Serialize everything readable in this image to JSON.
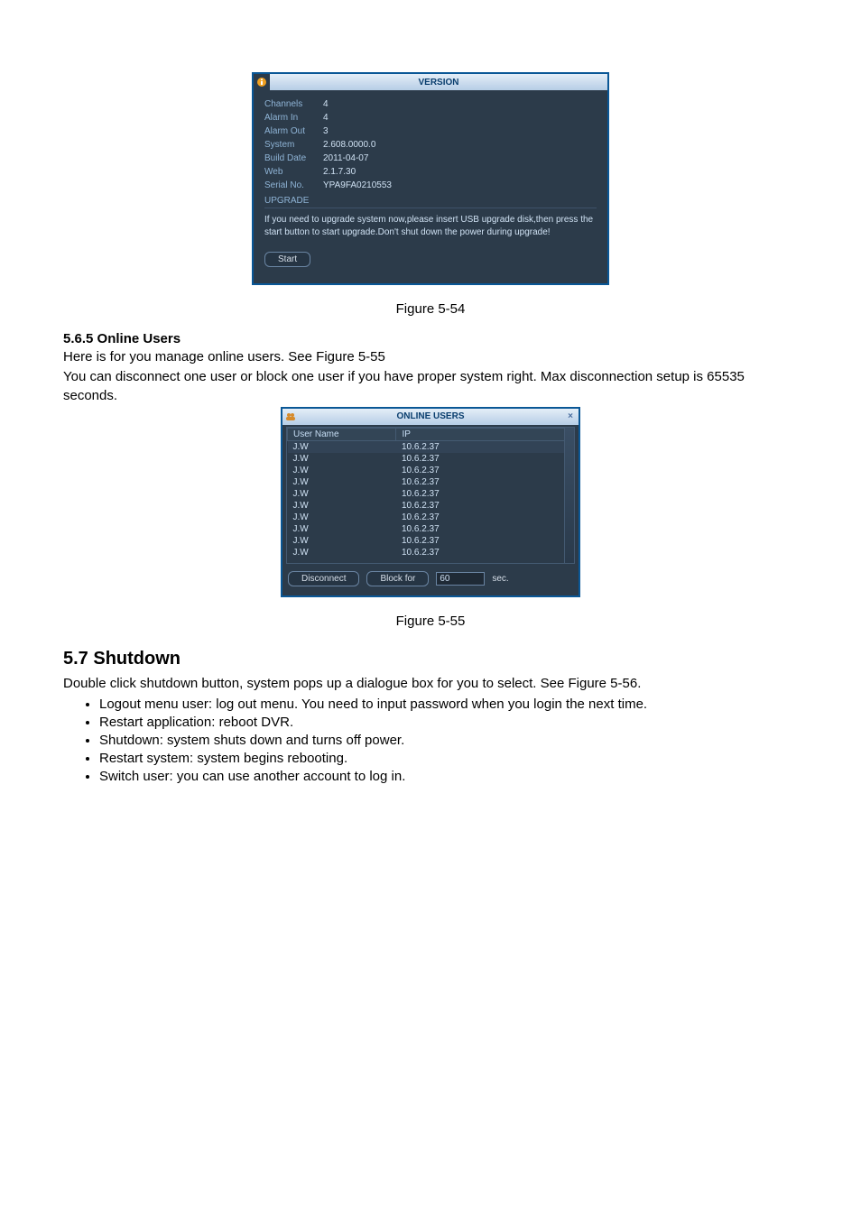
{
  "version_window": {
    "title": "VERSION",
    "rows": [
      {
        "k": "Channels",
        "v": "4"
      },
      {
        "k": "Alarm In",
        "v": "4"
      },
      {
        "k": "Alarm Out",
        "v": "3"
      },
      {
        "k": "System",
        "v": "2.608.0000.0"
      },
      {
        "k": "Build Date",
        "v": "2011-04-07"
      },
      {
        "k": "Web",
        "v": "2.1.7.30"
      },
      {
        "k": "Serial No.",
        "v": "YPA9FA0210553"
      }
    ],
    "upgrade_header": "UPGRADE",
    "upgrade_help": "If you need to upgrade system now,please insert USB upgrade disk,then press the start button to start upgrade.Don't shut down the power during upgrade!",
    "start_label": "Start"
  },
  "caption1": "Figure 5-54",
  "sec565_title": "5.6.5  Online Users",
  "sec565_p1": "Here is for you manage online users. See Figure 5-55",
  "sec565_p2": "You can disconnect one user or block one user if you have proper system right. Max disconnection setup is 65535 seconds.",
  "online_window": {
    "title": "ONLINE USERS",
    "col_user": "User Name",
    "col_ip": "IP",
    "rows": [
      {
        "name": "J.W",
        "ip": "10.6.2.37"
      },
      {
        "name": "J.W",
        "ip": "10.6.2.37"
      },
      {
        "name": "J.W",
        "ip": "10.6.2.37"
      },
      {
        "name": "J.W",
        "ip": "10.6.2.37"
      },
      {
        "name": "J.W",
        "ip": "10.6.2.37"
      },
      {
        "name": "J.W",
        "ip": "10.6.2.37"
      },
      {
        "name": "J.W",
        "ip": "10.6.2.37"
      },
      {
        "name": "J.W",
        "ip": "10.6.2.37"
      },
      {
        "name": "J.W",
        "ip": "10.6.2.37"
      },
      {
        "name": "J.W",
        "ip": "10.6.2.37"
      }
    ],
    "disconnect_label": "Disconnect",
    "blockfor_label": "Block for",
    "block_value": "60",
    "sec_label": "sec."
  },
  "caption2": "Figure 5-55",
  "sec57_title": "5.7  Shutdown",
  "sec57_p1": "Double click shutdown button, system pops up a dialogue box for you to select. See Figure 5-56.",
  "sec57_items": [
    "Logout menu user: log out menu. You need to input password when you login the next time.",
    "Restart application: reboot DVR.",
    "Shutdown: system shuts down and turns off power.",
    " Restart system: system begins rebooting.",
    "Switch user: you can use another account to log in."
  ]
}
